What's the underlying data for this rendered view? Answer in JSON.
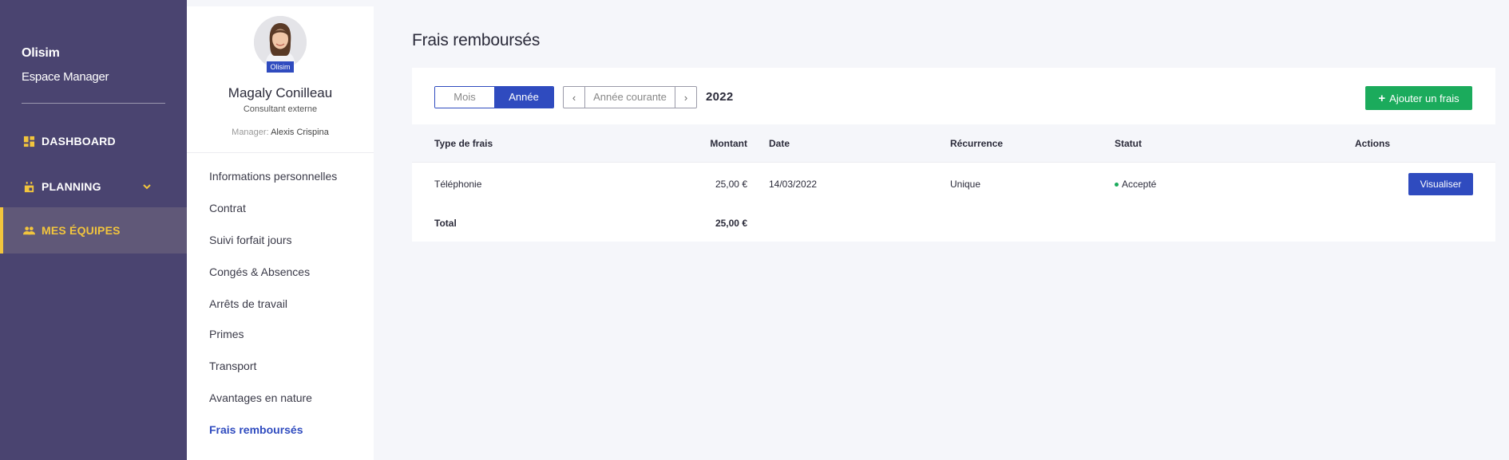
{
  "nav": {
    "brand_name": "Olisim",
    "brand_sub": "Espace Manager",
    "items": [
      {
        "label": "DASHBOARD",
        "icon": "dashboard-icon"
      },
      {
        "label": "PLANNING",
        "icon": "calendar-icon"
      },
      {
        "label": "MES ÉQUIPES",
        "icon": "team-icon"
      }
    ],
    "accent": "#f2c53d",
    "background": "#4a4470"
  },
  "profile": {
    "avatar_badge": "Olisim",
    "name": "Magaly Conilleau",
    "role": "Consultant externe",
    "manager_label": "Manager:",
    "manager_name": "Alexis Crispina",
    "menu": [
      "Informations personnelles",
      "Contrat",
      "Suivi forfait jours",
      "Congés & Absences",
      "Arrêts de travail",
      "Primes",
      "Transport",
      "Avantages en nature",
      "Frais remboursés"
    ]
  },
  "main": {
    "title": "Frais remboursés",
    "period_toggle": {
      "month": "Mois",
      "year": "Année"
    },
    "pager": {
      "prev": "‹",
      "current": "Année courante",
      "next": "›"
    },
    "year": "2022",
    "add_button": "Ajouter un frais",
    "table": {
      "headers": {
        "type": "Type de frais",
        "amount": "Montant",
        "date": "Date",
        "recurrence": "Récurrence",
        "status": "Statut",
        "actions": "Actions"
      },
      "rows": [
        {
          "type": "Téléphonie",
          "amount": "25,00 €",
          "date": "14/03/2022",
          "recurrence": "Unique",
          "status": "Accepté",
          "action": "Visualiser"
        }
      ],
      "total_label": "Total",
      "total_amount": "25,00 €"
    },
    "colors": {
      "primary": "#2f4bbf",
      "success": "#1bab5c"
    }
  }
}
